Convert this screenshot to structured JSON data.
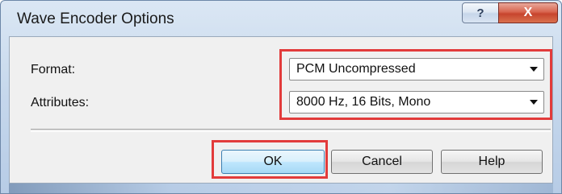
{
  "window": {
    "title": "Wave Encoder Options",
    "help_glyph": "?",
    "close_glyph": "X"
  },
  "form": {
    "format_label": "Format:",
    "format_value": "PCM Uncompressed",
    "attributes_label": "Attributes:",
    "attributes_value": "8000 Hz, 16 Bits, Mono"
  },
  "buttons": {
    "ok": "OK",
    "cancel": "Cancel",
    "help": "Help"
  },
  "colors": {
    "highlight": "#e23b3b",
    "close_button": "#c7442d"
  },
  "icons": [
    "help-icon",
    "close-icon",
    "dropdown-arrow-icon"
  ]
}
